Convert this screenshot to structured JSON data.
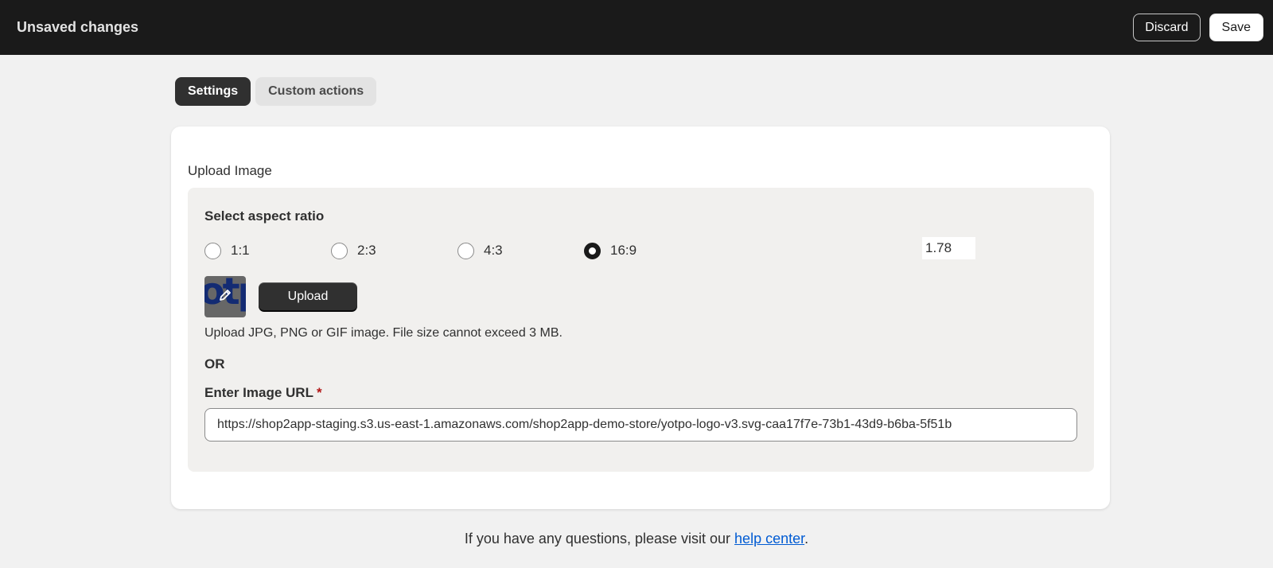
{
  "header": {
    "title": "Unsaved changes",
    "discard_label": "Discard",
    "save_label": "Save"
  },
  "tabs": [
    {
      "label": "Settings",
      "active": true
    },
    {
      "label": "Custom actions",
      "active": false
    }
  ],
  "upload_section": {
    "title": "Upload Image",
    "aspect_label": "Select aspect ratio",
    "ratios": [
      {
        "label": "1:1",
        "checked": false
      },
      {
        "label": "2:3",
        "checked": false
      },
      {
        "label": "4:3",
        "checked": false
      },
      {
        "label": "16:9",
        "checked": true
      }
    ],
    "ratio_value": "1.78",
    "thumb_text": "otp",
    "upload_label": "Upload",
    "upload_help": "Upload JPG, PNG or GIF image. File size cannot exceed 3 MB.",
    "or_label": "OR",
    "url_label": "Enter Image URL",
    "required_mark": "*",
    "url_value": "https://shop2app-staging.s3.us-east-1.amazonaws.com/shop2app-demo-store/yotpo-logo-v3.svg-caa17f7e-73b1-43d9-b6ba-5f51b"
  },
  "footer": {
    "text_before": "If you have any questions, please visit our ",
    "link_label": "help center",
    "text_after": "."
  },
  "colors": {
    "topbar_bg": "#1a1a1a",
    "page_bg": "#f1f1f1",
    "link": "#005bd3",
    "required": "#b11515"
  }
}
